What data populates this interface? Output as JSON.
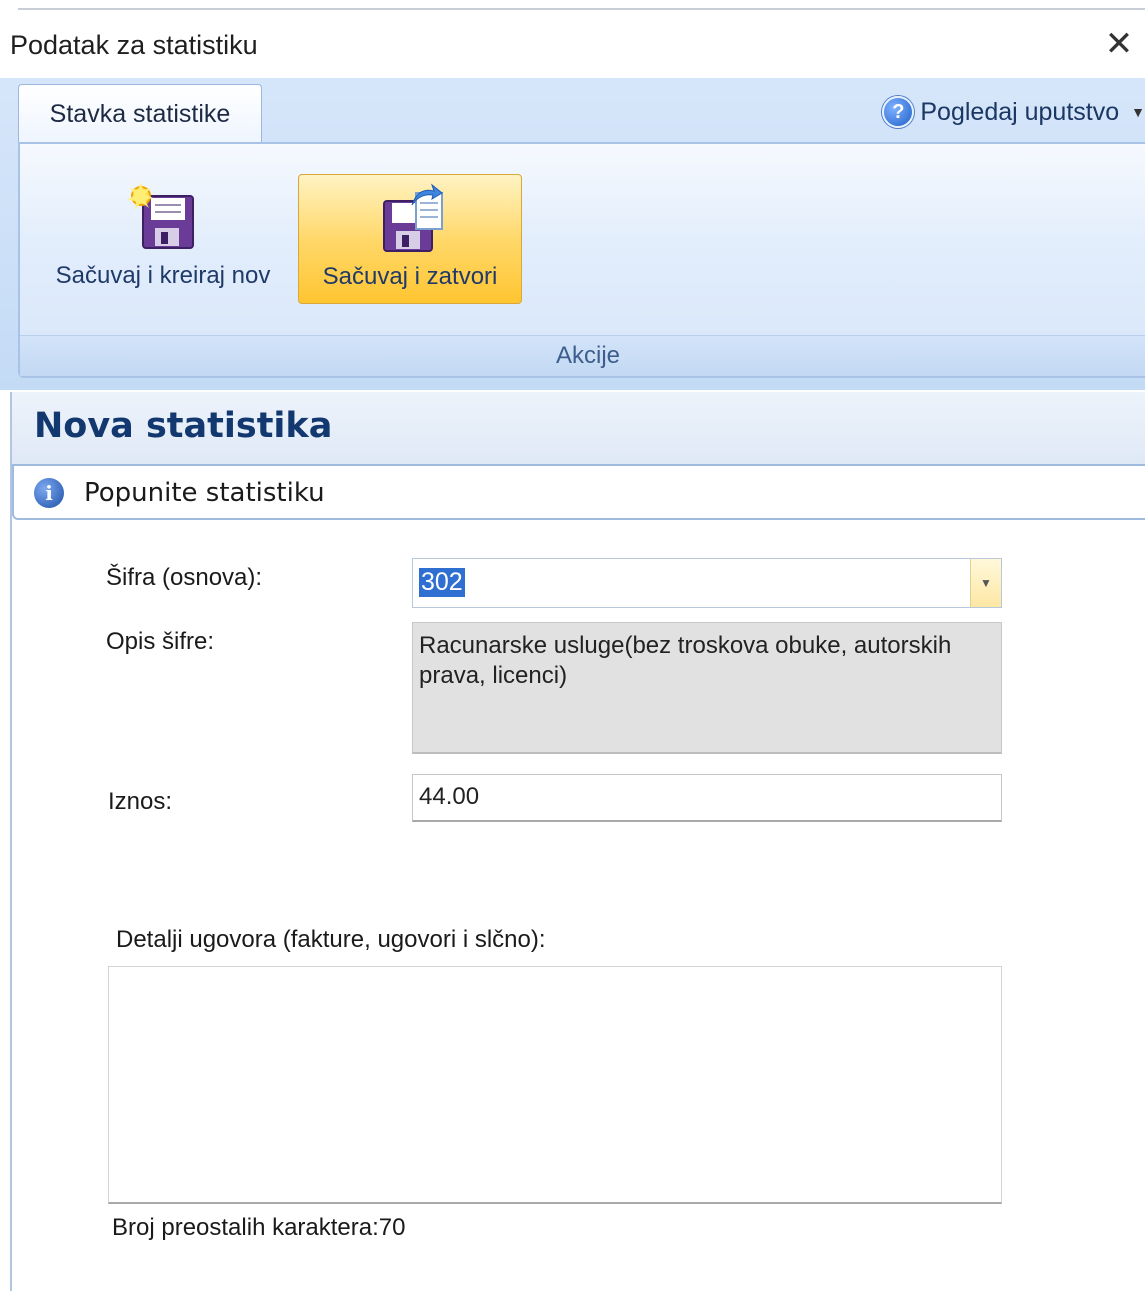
{
  "window": {
    "title": "Podatak za statistiku",
    "close_glyph": "✕"
  },
  "ribbon": {
    "tab_label": "Stavka statistike",
    "help_label": "Pogledaj uputstvo",
    "help_icon": "help-circle-icon",
    "buttons": {
      "save_new_label": "Sačuvaj i kreiraj nov",
      "save_close_label": "Sačuvaj i zatvori"
    },
    "group_label": "Akcije"
  },
  "main": {
    "title": "Nova statistika",
    "info_text": "Popunite statistiku",
    "fields": {
      "sifra_label": "Šifra (osnova):",
      "sifra_value": "302",
      "opis_label": "Opis šifre:",
      "opis_value": "Racunarske usluge(bez troskova obuke, autorskih prava, licenci)",
      "iznos_label": "Iznos:",
      "iznos_value": "44.00",
      "detalji_label": "Detalji ugovora (fakture, ugovori i slčno):",
      "detalji_value": "",
      "remaining_label": "Broj preostalih karaktera:70"
    }
  },
  "colors": {
    "ribbon_bg": "#c4dbf6",
    "active_button": "#ffd86a",
    "title_text": "#12386f"
  }
}
